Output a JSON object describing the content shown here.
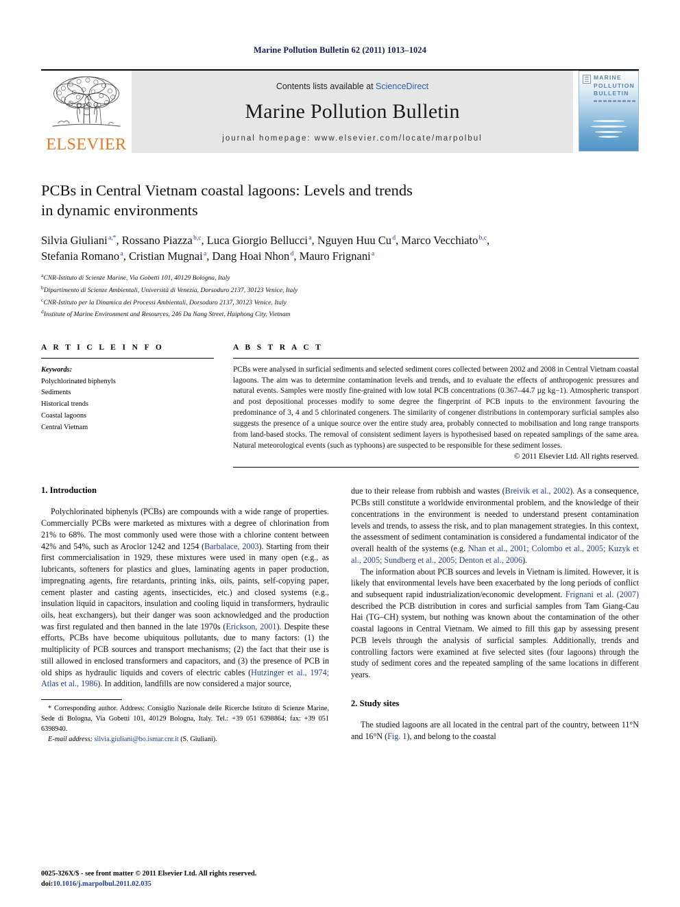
{
  "running_head": "Marine Pollution Bulletin 62 (2011) 1013–1024",
  "masthead": {
    "publisher_name": "ELSEVIER",
    "contents_prefix": "Contents lists available at ",
    "contents_link": "ScienceDirect",
    "journal_title": "Marine Pollution Bulletin",
    "homepage": "journal homepage: www.elsevier.com/locate/marpolbul",
    "cover_title": "MARINE POLLUTION BULLETIN",
    "link_color": "#2a5fb0",
    "brand_color": "#E87722"
  },
  "article": {
    "title_line1": "PCBs in Central Vietnam coastal lagoons: Levels and trends",
    "title_line2": "in dynamic environments",
    "authors_line1": "Silvia Giuliani a,*, Rossano Piazza b,c, Luca Giorgio Bellucci a, Nguyen Huu Cu d, Marco Vecchiato b,c,",
    "authors_line2": "Stefania Romano a, Cristian Mugnai a, Dang Hoai Nhon d, Mauro Frignani a",
    "affiliations": [
      "CNR-Istituto di Scienze Marine, Via Gobetti 101, 40129 Bologna, Italy",
      "Dipartimento di Scienze Ambientali, Università di Venezia, Dorsoduro 2137, 30123 Venice, Italy",
      "CNR-Istituto per la Dinamica dei Processi Ambientali, Dorsoduro 2137, 30123 Venice, Italy",
      "Institute of Marine Environment and Resources, 246 Da Nang Street, Haiphong City, Vietnam"
    ],
    "affiliation_marks": [
      "a",
      "b",
      "c",
      "d"
    ]
  },
  "article_info": {
    "heading": "A R T I C L E    I N F O",
    "keywords_label": "Keywords:",
    "keywords": [
      "Polychlorinated biphenyls",
      "Sediments",
      "Historical trends",
      "Coastal lagoons",
      "Central Vietnam"
    ]
  },
  "abstract": {
    "heading": "A B S T R A C T",
    "text": "PCBs were analysed in surficial sediments and selected sediment cores collected between 2002 and 2008 in Central Vietnam coastal lagoons. The aim was to determine contamination levels and trends, and to evaluate the effects of anthropogenic pressures and natural events. Samples were mostly fine-grained with low total PCB concentrations (0.367–44.7 µg kg−1). Atmospheric transport and post depositional processes modify to some degree the fingerprint of PCB inputs to the environment favouring the predominance of 3, 4 and 5 chlorinated congeners. The similarity of congener distributions in contemporary surficial samples also suggests the presence of a unique source over the entire study area, probably connected to mobilisation and long range transports from land-based stocks. The removal of consistent sediment layers is hypothesised based on repeated samplings of the same area. Natural meteorological events (such as typhoons) are suspected to be responsible for these sediment losses.",
    "copyright": "© 2011 Elsevier Ltd. All rights reserved."
  },
  "sections": {
    "introduction_heading": "1. Introduction",
    "study_sites_heading": "2. Study sites",
    "intro_p1_a": "Polychlorinated biphenyls (PCBs) are compounds with a wide range of properties. Commercially PCBs were marketed as mixtures with a degree of chlorination from 21% to 68%. The most commonly used were those with a chlorine content between 42% and 54%, such as Aroclor 1242 and 1254 (",
    "intro_cite_barbalace": "Barbalace, 2003",
    "intro_p1_b": "). Starting from their first commercialisation in 1929, these mixtures were used in many open (e.g., as lubricants, softeners for plastics and glues, laminating agents in paper production, impregnating agents, fire retardants, printing inks, oils, paints, self-copying paper, cement plaster and casting agents, insecticides, etc.) and closed systems (e.g., insulation liquid in capacitors, insulation and cooling liquid in transformers, hydraulic oils, heat exchangers), but their danger was soon acknowledged and the production was first regulated and then banned in the late 1970s (",
    "intro_cite_erickson": "Erickson, 2001",
    "intro_p1_c": "). Despite these efforts, PCBs have become ubiquitous pollutants, due to many factors: (1) the multiplicity of PCB sources and transport mechanisms; (2) the fact that their use is still allowed in enclosed transformers and capacitors, and (3) the presence of PCB in old ships as hydraulic liquids and covers of electric cables (",
    "intro_cite_hutzinger": "Hutzinger et al., 1974; Atlas et al., 1986",
    "intro_p1_d": "). In addition, landfills are now considered a major source, ",
    "intro_p1_e": "due to their release from rubbish and wastes (",
    "intro_cite_breivik": "Breivik et al., 2002",
    "intro_p1_f": "). As a consequence, PCBs still constitute a worldwide environmental problem, and the knowledge of their concentrations in the environment is needed to understand present contamination levels and trends, to assess the risk, and to plan management strategies. In this context, the assessment of sediment contamination is considered a fundamental indicator of the overall health of the systems (e.g. ",
    "intro_cite_nhan": "Nhan et al., 2001; Colombo et al., 2005; Kuzyk et al., 2005; Sundberg et al., 2005; Denton et al., 2006",
    "intro_p1_g": ").",
    "intro_p2_a": "The information about PCB sources and levels in Vietnam is limited. However, it is likely that environmental levels have been exacerbated by the long periods of conflict and subsequent rapid industrialization/economic development. ",
    "intro_cite_frignani": "Frignani et al. (2007)",
    "intro_p2_b": " described the PCB distribution in cores and surficial samples from Tam Giang-Cau Hai (TG–CH) system, but nothing was known about the contamination of the other coastal lagoons in Central Vietnam. We aimed to fill this gap by assessing present PCB levels through the analysis of surficial samples. Additionally, trends and controlling factors were examined at five selected sites (four lagoons) through the study of sediment cores and the repeated sampling of the same locations in different years.",
    "study_p1_a": "The studied lagoons are all located in the central part of the country, between 11°N and 16°N (",
    "study_cite_fig1": "Fig. 1",
    "study_p1_b": "), and belong to the coastal"
  },
  "footnote": {
    "marker": "*",
    "text": " Corresponding author. Address: Consiglio Nazionale delle Ricerche Istituto di Scienze Marine, Sede di Bologna, Via Gobetti 101, 40129 Bologna, Italy. Tel.: +39 051 6398864; fax: +39 051 6398940.",
    "email_label": "E-mail address:",
    "email": "silvia.giuliani@bo.ismar.cnr.it",
    "email_suffix": " (S. Giuliani)."
  },
  "page_footer": {
    "issn_line": "0025-326X/$ - see front matter © 2011 Elsevier Ltd. All rights reserved.",
    "doi_prefix": "doi:",
    "doi": "10.1016/j.marpolbul.2011.02.035"
  }
}
